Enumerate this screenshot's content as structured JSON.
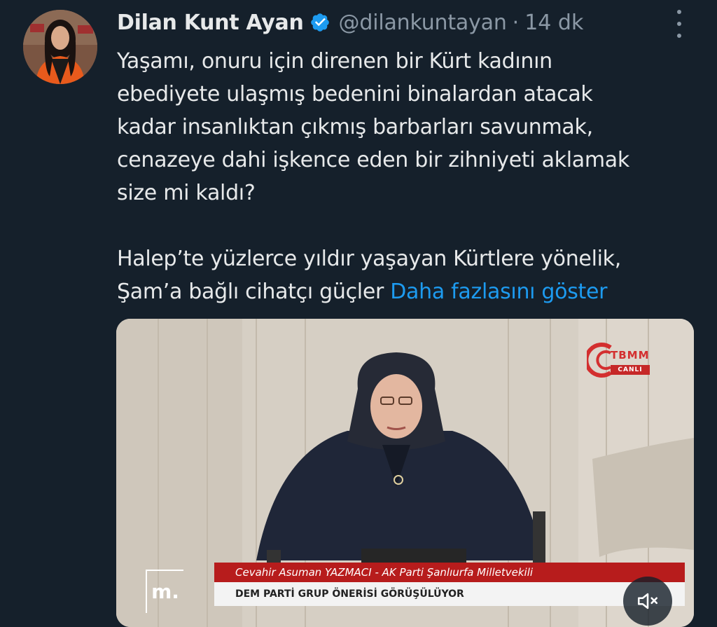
{
  "author": {
    "name": "Dilan Kunt Ayan",
    "handle": "@dilankuntayan",
    "separator": "·",
    "time": "14 dk"
  },
  "tweet": {
    "lines_p1": [
      "Yaşamı, onuru için direnen bir Kürt kadının",
      "ebediyete ulaşmış bedenini binalardan atacak",
      "kadar insanlıktan çıkmış barbarları savunmak,",
      "cenazeye dahi işkence eden bir zihniyeti aklamak",
      "size mi kaldı?"
    ],
    "line_p2_1": "Halep’te yüzlerce yıldır yaşayan Kürtlere yönelik,",
    "line_p2_2": "Şam’a bağlı cihatçı güçler ",
    "show_more": "Daha fazlasını göster"
  },
  "media": {
    "broadcaster_logo": "TBMM",
    "live_label": "CANLI",
    "caption_speaker": "Cevahir Asuman YAZMACI - AK Parti Şanlıurfa Milletvekili",
    "caption_topic": "DEM PARTİ GRUP ÖNERİSİ GÖRÜŞÜLÜYOR",
    "corner_logo": "m.",
    "mute_icon": "speaker-muted-icon"
  },
  "colors": {
    "background": "#15202b",
    "link": "#1d9bf0",
    "secondary_text": "#8b98a5",
    "verified_badge": "#1d9bf0"
  }
}
